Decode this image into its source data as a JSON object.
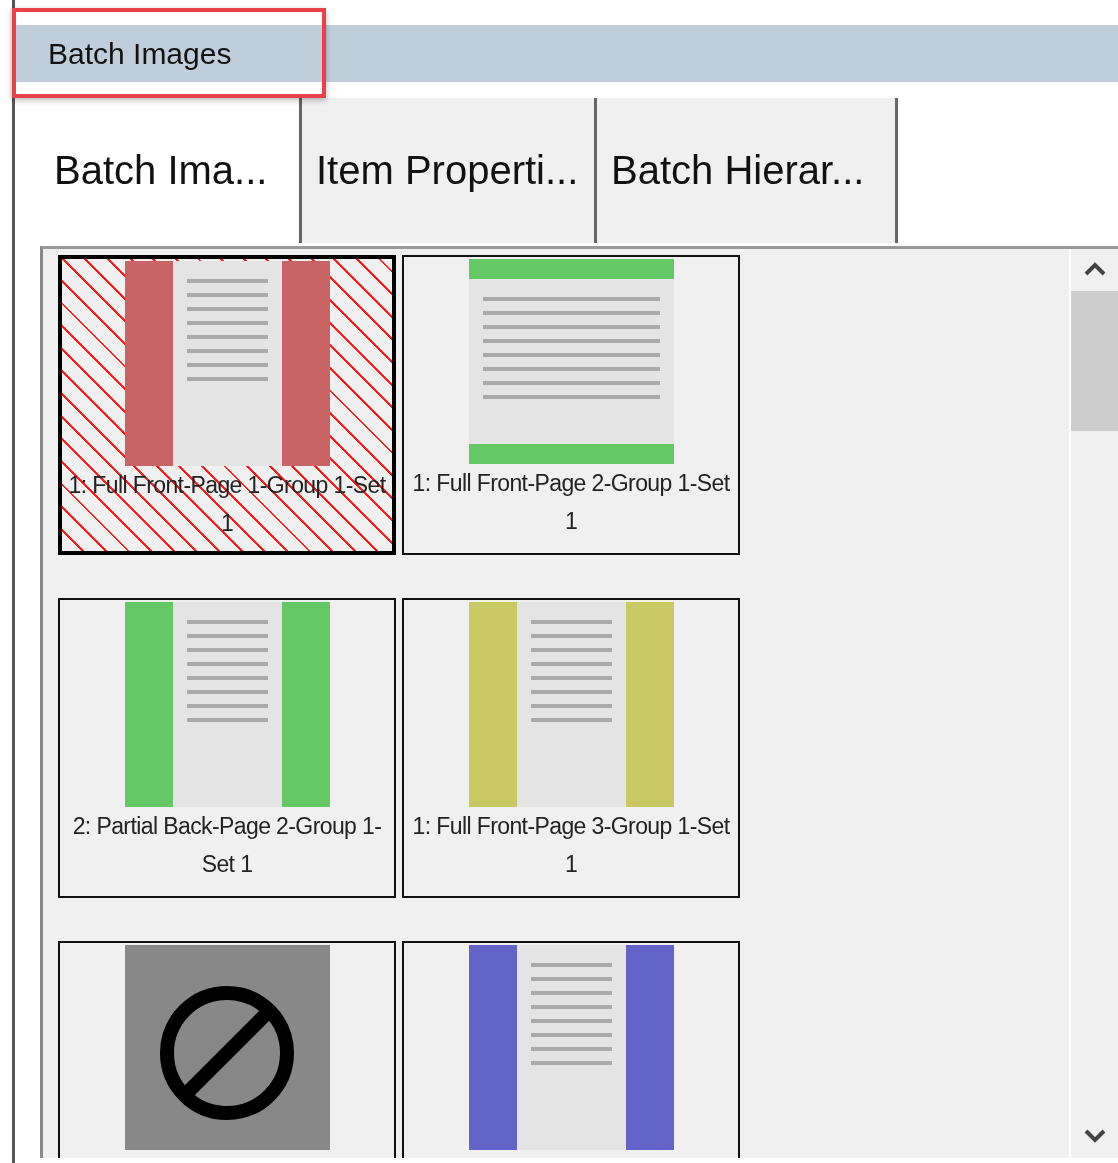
{
  "panel": {
    "title": "Batch Images",
    "highlighted": true
  },
  "tabs": [
    {
      "label": "Batch Ima...",
      "selected": true
    },
    {
      "label": "Item Properti...",
      "selected": false
    },
    {
      "label": "Batch Hierar...",
      "selected": false
    }
  ],
  "thumbnails": [
    {
      "kind": "side-bars",
      "color": "#c86464",
      "caption": "1: Full Front-Page 1-Group 1-Set 1",
      "selected": true
    },
    {
      "kind": "top-bars",
      "color": "#64c864",
      "caption": "1: Full Front-Page 2-Group 1-Set 1",
      "selected": false
    },
    {
      "kind": "side-bars",
      "color": "#64c864",
      "caption": "2: Partial Back-Page 2-Group 1-Set 1",
      "selected": false
    },
    {
      "kind": "side-bars",
      "color": "#c8c864",
      "caption": "1: Full Front-Page 3-Group 1-Set 1",
      "selected": false
    },
    {
      "kind": "missing",
      "selected": false
    },
    {
      "kind": "side-bars",
      "color": "#6464c8",
      "selected": false
    }
  ]
}
